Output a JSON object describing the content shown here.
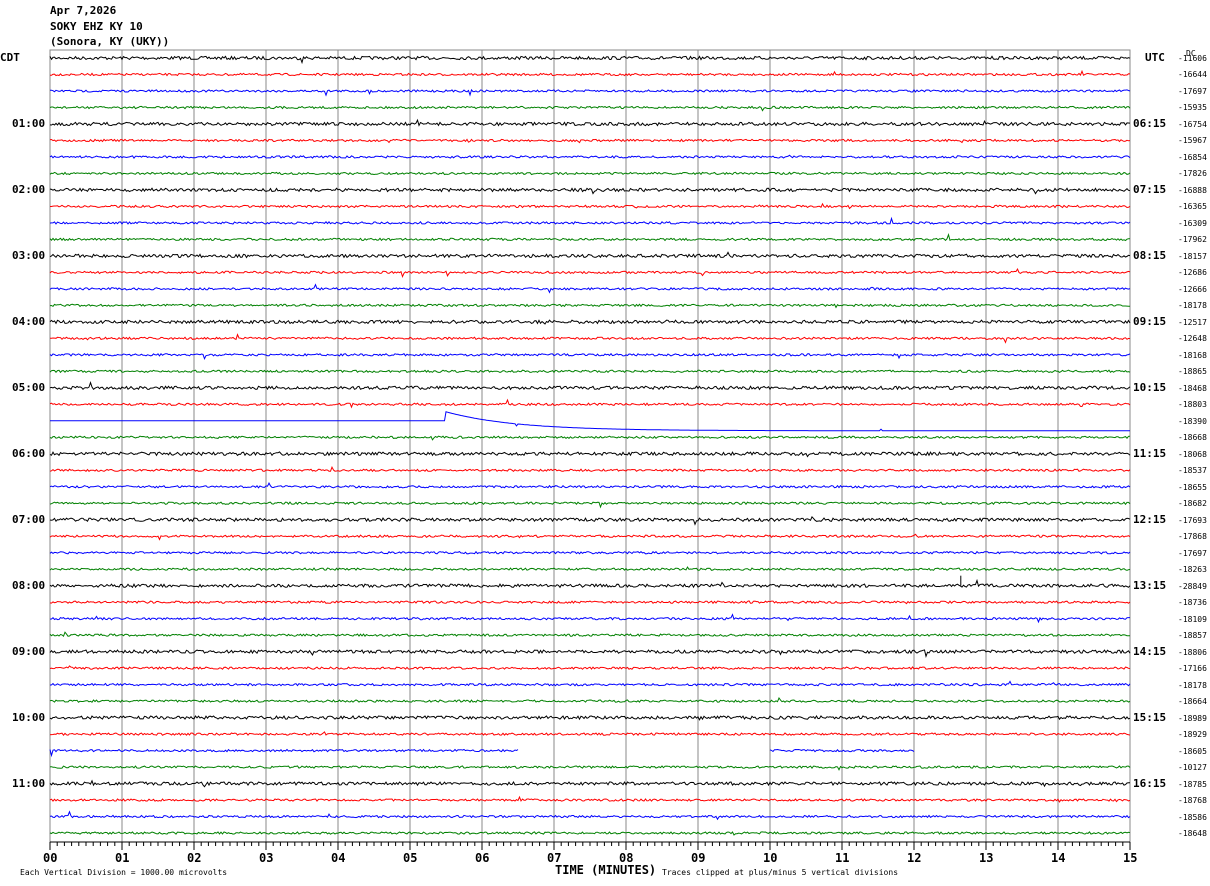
{
  "header": {
    "date": "Apr 7,2026",
    "station": "SOKY EHZ KY 10",
    "location": "(Sonora, KY (UKY))"
  },
  "left_tz": "CDT",
  "right_tz": "UTC",
  "dc_label": "DC",
  "footer": {
    "scale": "Each Vertical Division = 1000.00 microvolts",
    "xlabel": "TIME (MINUTES)",
    "clip": "Traces clipped at plus/minus 5 vertical divisions"
  },
  "chart_data": {
    "type": "line",
    "title": "SOKY EHZ KY 10 helicorder",
    "xlabel": "TIME (MINUTES)",
    "xlim": [
      0,
      15
    ],
    "x_ticks": [
      "00",
      "01",
      "02",
      "03",
      "04",
      "05",
      "06",
      "07",
      "08",
      "09",
      "10",
      "11",
      "12",
      "13",
      "14",
      "15"
    ],
    "rows_per_hour": 4,
    "row_minutes": 15,
    "trace_colors": [
      "#000000",
      "#ff0000",
      "#0000ff",
      "#008000"
    ],
    "left_hour_labels": [
      "01:00",
      "02:00",
      "03:00",
      "04:00",
      "05:00",
      "06:00",
      "07:00",
      "08:00",
      "09:00",
      "10:00",
      "11:00"
    ],
    "right_hour_labels": [
      "06:15",
      "07:15",
      "08:15",
      "09:15",
      "10:15",
      "11:15",
      "12:15",
      "13:15",
      "14:15",
      "15:15",
      "16:15"
    ],
    "dc_offsets": [
      "-11606",
      "-16644",
      "-17697",
      "-15935",
      "-16754",
      "-15967",
      "-16854",
      "-17826",
      "-16888",
      "-16365",
      "-16309",
      "-17962",
      "-18157",
      "-12686",
      "-12666",
      "-18178",
      "-12517",
      "-12648",
      "-18168",
      "-18865",
      "-18468",
      "-18803",
      "-18390",
      "-18668",
      "-18068",
      "-18537",
      "-18655",
      "-18682",
      "-17693",
      "-17868",
      "-17697",
      "-18263",
      "-28849",
      "-18736",
      "-18109",
      "-18857",
      "-18806",
      "-17166",
      "-18178",
      "-18664",
      "-18989",
      "-18929",
      "-18605",
      "-10127",
      "-18785",
      "-18768",
      "-18586",
      "-18648"
    ],
    "events": [
      {
        "row": 22,
        "minute": 5.5,
        "type": "step-decay"
      },
      {
        "row": 32,
        "minute": 12.65,
        "type": "spike"
      },
      {
        "row": 42,
        "gap_minutes": [
          6.5,
          10
        ]
      }
    ]
  }
}
